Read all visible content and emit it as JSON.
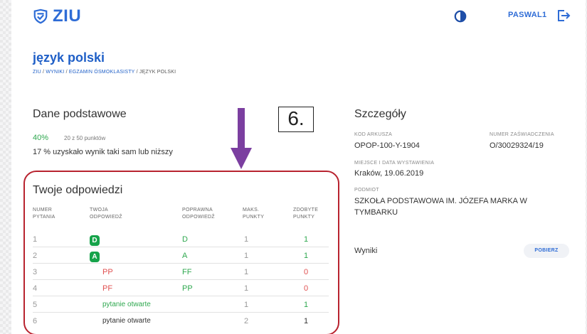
{
  "app": {
    "logo_text": "ZIU",
    "user": "PASWAL1"
  },
  "page": {
    "title": "język polski",
    "breadcrumb": [
      "ZIU",
      "WYNIKI",
      "EGZAMIN ÓSMOKLASISTY",
      "JĘZYK POLSKI"
    ],
    "breadcrumb_sep": " / "
  },
  "basic": {
    "heading": "Dane podstawowe",
    "percent": "40%",
    "points": "20 z 50 punktów",
    "stat": "17 % uzyskało wynik taki sam lub niższy"
  },
  "annotation": {
    "number": "6."
  },
  "answers": {
    "heading": "Twoje odpowiedzi",
    "columns": [
      {
        "line1": "NUMER",
        "line2": "PYTANIA"
      },
      {
        "line1": "TWOJA",
        "line2": "ODPOWIEDŹ"
      },
      {
        "line1": "POPRAWNA",
        "line2": "ODPOWIEDŹ"
      },
      {
        "line1": "MAKS.",
        "line2": "PUNKTY"
      },
      {
        "line1": "ZDOBYTE",
        "line2": "PUNKTY"
      }
    ],
    "rows": [
      {
        "num": "1",
        "yours": "D",
        "yours_style": "badge",
        "correct": "D",
        "max": "1",
        "points": "1",
        "points_color": "#2fa84f"
      },
      {
        "num": "2",
        "yours": "A",
        "yours_style": "badge",
        "correct": "A",
        "max": "1",
        "points": "1",
        "points_color": "#2fa84f"
      },
      {
        "num": "3",
        "yours": "PP",
        "yours_style": "red",
        "correct": "FF",
        "max": "1",
        "points": "0",
        "points_color": "#e05050"
      },
      {
        "num": "4",
        "yours": "PF",
        "yours_style": "red",
        "correct": "PP",
        "max": "1",
        "points": "0",
        "points_color": "#e05050"
      },
      {
        "num": "5",
        "yours": "pytanie otwarte",
        "yours_style": "green",
        "correct": "",
        "max": "1",
        "points": "1",
        "points_color": "#2fa84f"
      },
      {
        "num": "6",
        "yours": "pytanie otwarte",
        "yours_style": "dark",
        "correct": "",
        "max": "2",
        "points": "1",
        "points_color": "#333333"
      }
    ]
  },
  "details": {
    "heading": "Szczegóły",
    "kod_label": "KOD ARKUSZA",
    "kod_value": "OPOP-100-Y-1904",
    "numer_label": "NUMER ZAŚWIADCZENIA",
    "numer_value": "O/30029324/19",
    "miejsce_label": "MIEJSCE I DATA WYSTAWIENIA",
    "miejsce_value": "Kraków, 19.06.2019",
    "podmiot_label": "PODMIOT",
    "podmiot_line1": "SZKOŁA PODSTAWOWA IM. JÓZEFA MARKA W",
    "podmiot_line2": "TYMBARKU",
    "wyniki_label": "Wyniki",
    "download_label": "POBIERZ"
  },
  "colors": {
    "accent": "#2e6cd6",
    "success": "#2fa84f",
    "error": "#e05050",
    "annotation_ring": "#b8232f",
    "annotation_arrow": "#7b3fa0"
  }
}
